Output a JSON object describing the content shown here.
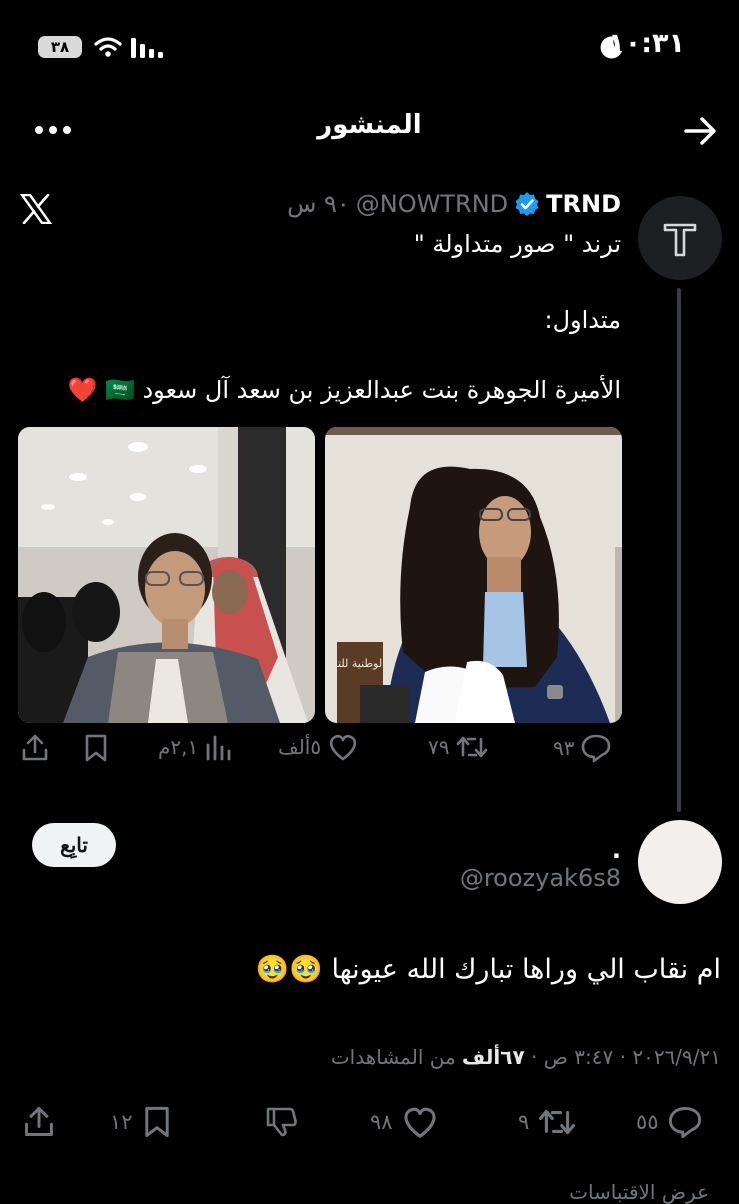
{
  "status_bar": {
    "time": "١٠:٣١",
    "battery": "٣٨"
  },
  "header": {
    "title": "المنشور"
  },
  "quoted_post": {
    "author_name": "TRND",
    "author_handle": "@NOWTRND",
    "time": "٩٠ س",
    "avatar_letter": "T",
    "lines": [
      "ترند \" صور متداولة \"",
      "متداول:",
      "الأميرة الجوهرة بنت عبدالعزيز بن سعد آل سعود 🇸🇦 ❤️"
    ],
    "photo_caption": "الوطنية للتا",
    "stats": {
      "replies": "٩٣",
      "reposts": "٧٩",
      "likes": "٥ألف",
      "views": "٢,١م"
    }
  },
  "main_post": {
    "name": ".",
    "handle": "@roozyak6s8",
    "follow_label": "تابِع",
    "text": "ام نقاب الي وراها تبارك الله عيونها 🥹🥹",
    "meta": {
      "date": "٢٠٢٦/٩/٢١",
      "time": "٣:٤٧ ص",
      "views_count": "٦٧ألف",
      "views_label": "من المشاهدات"
    },
    "stats": {
      "replies": "٥٥",
      "reposts": "٩",
      "likes": "٩٨",
      "bookmarks": "١٢"
    }
  },
  "bottom_text": "عرض الاقتباسات"
}
